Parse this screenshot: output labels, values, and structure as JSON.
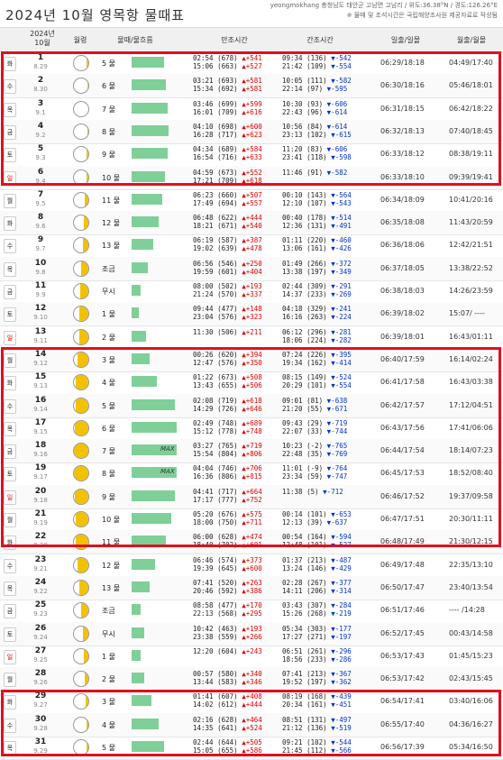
{
  "header": {
    "title": "2024년 10월 영목항 물때표",
    "sub1": "yeongmokhang 충청남도 태안군 고남면 고남리 / 위도:36.38°N / 경도:126.26°E",
    "sub2": "※ 물때 및 조석시간은 국립해양조사원 제공자료로 작성됨"
  },
  "columns": {
    "date": "2024년\n10월",
    "moon": "월령",
    "mul": "물때/물흐름",
    "high": "만조시간",
    "low": "간조시간",
    "sun": "일출/일몰",
    "moonrise": "월출/월몰"
  },
  "rows": [
    {
      "dow": "화",
      "sun": false,
      "day": "1",
      "date": "8.29",
      "phase": 0.15,
      "mul": "5 물",
      "bar": 36,
      "hi": [
        "02:54 (678)",
        "▲+541",
        "15:06 (663)",
        "▲+527"
      ],
      "lo": [
        "09:34 (136)",
        "▼-542",
        "21:42 (109)",
        "▼-554"
      ],
      "sunT": "06:29/18:18",
      "moonT": "04:49/17:40"
    },
    {
      "dow": "수",
      "sun": false,
      "day": "2",
      "date": "8.30",
      "phase": 0.05,
      "mul": "6 물",
      "bar": 38,
      "hi": [
        "03:21 (693)",
        "▲+581",
        "15:34 (692)",
        "▲+581"
      ],
      "lo": [
        "10:05 (111)",
        "▼-582",
        "22:14 (97)",
        "▼-595"
      ],
      "sunT": "06:30/18:16",
      "moonT": "05:46/18:01"
    },
    {
      "dow": "목",
      "sun": false,
      "day": "3",
      "date": "9.1",
      "phase": 0.0,
      "mul": "7 물",
      "bar": 40,
      "hi": [
        "03:46 (699)",
        "▲+599",
        "16:01 (709)",
        "▲+616"
      ],
      "lo": [
        "10:30 (93)",
        "▼-606",
        "22:43 (96)",
        "▼-614"
      ],
      "sunT": "06:31/18:15",
      "moonT": "06:42/18:22"
    },
    {
      "dow": "금",
      "sun": false,
      "day": "4",
      "date": "9.2",
      "phase": 0.05,
      "mul": "8 물",
      "bar": 41,
      "hi": [
        "04:10 (698)",
        "▲+600",
        "16:28 (717)",
        "▲+623"
      ],
      "lo": [
        "10:56 (84)",
        "▼-614",
        "23:13 (102)",
        "▼-615"
      ],
      "sunT": "06:32/18:13",
      "moonT": "07:40/18:45"
    },
    {
      "dow": "토",
      "sun": false,
      "day": "5",
      "date": "9.3",
      "phase": 0.1,
      "mul": "9 물",
      "bar": 40,
      "hi": [
        "04:34 (689)",
        "▲+584",
        "16:54 (716)",
        "▲+633"
      ],
      "lo": [
        "11:20 (83)",
        "▼-606",
        "23:41 (118)",
        "▼-598"
      ],
      "sunT": "06:33/18:12",
      "moonT": "08:38/19:11"
    },
    {
      "dow": "일",
      "sun": true,
      "day": "6",
      "date": "9.4",
      "phase": 0.15,
      "mul": "10 물",
      "bar": 37,
      "hi": [
        "04:59 (673)",
        "▲+552",
        "17:21 (709)",
        "▲+618"
      ],
      "lo": [
        "11:46 (91)",
        "▼-582",
        "",
        " "
      ],
      "sunT": "06:33/18:10",
      "moonT": "09:39/19:41"
    },
    {
      "dow": "월",
      "sun": false,
      "day": "7",
      "date": "9.5",
      "phase": 0.25,
      "mul": "11 물",
      "bar": 34,
      "hi": [
        "06:23 (660)",
        "▲+507",
        "17:49 (694)",
        "▲+557"
      ],
      "lo": [
        "00:10 (143)",
        "▼-564",
        "12:10 (107)",
        "▼-543"
      ],
      "sunT": "06:34/18:09",
      "moonT": "10:41/20:16"
    },
    {
      "dow": "화",
      "sun": false,
      "day": "8",
      "date": "9.6",
      "phase": 0.3,
      "mul": "12 물",
      "bar": 30,
      "hi": [
        "06:48 (622)",
        "▲+444",
        "18:21 (671)",
        "▲+540"
      ],
      "lo": [
        "00:40 (178)",
        "▼-514",
        "12:36 (131)",
        "▼-491"
      ],
      "sunT": "06:35/18:08",
      "moonT": "11:43/20:59"
    },
    {
      "dow": "수",
      "sun": false,
      "day": "9",
      "date": "9.7",
      "phase": 0.4,
      "mul": "13 물",
      "bar": 24,
      "hi": [
        "06:19 (587)",
        "▲+387",
        "19:02 (639)",
        "▲+478"
      ],
      "lo": [
        "01:11 (220)",
        "▼-460",
        "13:06 (161)",
        "▼-426"
      ],
      "sunT": "06:36/18:06",
      "moonT": "12:42/21:51"
    },
    {
      "dow": "목",
      "sun": false,
      "day": "10",
      "date": "9.8",
      "phase": 0.5,
      "mul": "조금",
      "bar": 18,
      "hi": [
        "06:56 (546)",
        "▲+250",
        "19:59 (601)",
        "▲+404"
      ],
      "lo": [
        "01:49 (266)",
        "▼-372",
        "13:38 (197)",
        "▼-349"
      ],
      "sunT": "06:37/18:05",
      "moonT": "13:38/22:52"
    },
    {
      "dow": "금",
      "sun": false,
      "day": "11",
      "date": "9.9",
      "phase": 0.55,
      "mul": "무시",
      "bar": 10,
      "hi": [
        "08:00 (502)",
        "▲+193",
        "21:24 (570)",
        "▲+337"
      ],
      "lo": [
        "02:44 (309)",
        "▼-291",
        "14:37 (233)",
        "▼-269"
      ],
      "sunT": "06:38/18:03",
      "moonT": "14:26/23:59"
    },
    {
      "dow": "토",
      "sun": false,
      "day": "12",
      "date": "9.10",
      "phase": 0.6,
      "mul": "1 물",
      "bar": 8,
      "hi": [
        "09:44 (477)",
        "▲+148",
        "23:04 (576)",
        "▲+323"
      ],
      "lo": [
        "04:18 (329)",
        "▼-241",
        "16:16 (263)",
        "▼-224"
      ],
      "sunT": "06:39/18:02",
      "moonT": "15:07/ ----"
    },
    {
      "dow": "일",
      "sun": true,
      "day": "13",
      "date": "9.11",
      "phase": 0.65,
      "mul": "2 물",
      "bar": 16,
      "hi": [
        "11:30 (506)",
        "▲+211",
        "",
        " "
      ],
      "lo": [
        "06:12 (296)",
        "▼-281",
        "18:06 (224)",
        "▼-282"
      ],
      "sunT": "06:39/18:01",
      "moonT": "16:43/01:11"
    },
    {
      "dow": "월",
      "sun": false,
      "day": "14",
      "date": "9.12",
      "phase": 0.75,
      "mul": "3 물",
      "bar": 20,
      "hi": [
        "00:26 (620)",
        "▲+394",
        "12:47 (576)",
        "▲+350"
      ],
      "lo": [
        "07:24 (226)",
        "▼-395",
        "19:34 (162)",
        "▼-414"
      ],
      "sunT": "06:40/17:59",
      "moonT": "16:14/02:24"
    },
    {
      "dow": "화",
      "sun": false,
      "day": "15",
      "date": "9.13",
      "phase": 0.85,
      "mul": "4 물",
      "bar": 28,
      "hi": [
        "01:22 (673)",
        "▲+508",
        "13:43 (655)",
        "▲+506"
      ],
      "lo": [
        "08:15 (149)",
        "▼-524",
        "20:29 (101)",
        "▼-554"
      ],
      "sunT": "06:41/17:58",
      "moonT": "16:43/03:38"
    },
    {
      "dow": "수",
      "sun": false,
      "day": "16",
      "date": "9.14",
      "phase": 0.9,
      "mul": "5 물",
      "bar": 48,
      "hi": [
        "02:08 (719)",
        "▲+618",
        "14:29 (726)",
        "▲+646"
      ],
      "lo": [
        "09:01 (81)",
        "▼-638",
        "21:20 (55)",
        "▼-671"
      ],
      "sunT": "06:42/17:57",
      "moonT": "17:12/04:51"
    },
    {
      "dow": "목",
      "sun": false,
      "day": "17",
      "date": "9.15",
      "phase": 0.95,
      "mul": "6 물",
      "bar": 50,
      "hi": [
        "02:49 (748)",
        "▲+689",
        "15:12 (778)",
        "▲+748"
      ],
      "lo": [
        "09:43 (29)",
        "▼-719",
        "22:07 (33)",
        "▼-744"
      ],
      "sunT": "06:43/17:56",
      "moonT": "17:41/06:06"
    },
    {
      "dow": "금",
      "sun": false,
      "day": "18",
      "date": "9.16",
      "phase": 1.0,
      "mul": "7 물",
      "bar": 50,
      "max": true,
      "hi": [
        "03:27 (765)",
        "▲+719",
        "15:54 (804)",
        "▲+806"
      ],
      "lo": [
        "10:23 (-2)",
        "▼-765",
        "22:48 (35)",
        "▼-769"
      ],
      "sunT": "06:44/17:54",
      "moonT": "18:14/07:23"
    },
    {
      "dow": "토",
      "sun": false,
      "day": "19",
      "date": "9.17",
      "phase": 1.0,
      "mul": "8 물",
      "bar": 50,
      "max": true,
      "hi": [
        "04:04 (746)",
        "▲+706",
        "16:36 (806)",
        "▲+815"
      ],
      "lo": [
        "11:01 (-9)",
        "▼-764",
        "23:34 (59)",
        "▼-747"
      ],
      "sunT": "06:45/17:53",
      "moonT": "18:52/08:40"
    },
    {
      "dow": "일",
      "sun": true,
      "day": "20",
      "date": "9.18",
      "phase": 0.95,
      "mul": "9 물",
      "bar": 48,
      "hi": [
        "04:41 (717)",
        "▲+664",
        "17:17 (777)",
        "▲+752"
      ],
      "lo": [
        "11:38 (5)",
        "▼-712",
        "",
        " "
      ],
      "sunT": "06:46/17:52",
      "moonT": "19:37/09:58"
    },
    {
      "dow": "월",
      "sun": false,
      "day": "21",
      "date": "9.19",
      "phase": 0.9,
      "mul": "10 물",
      "bar": 44,
      "hi": [
        "05:20 (676)",
        "▲+575",
        "18:00 (750)",
        "▲+711"
      ],
      "lo": [
        "00:14 (101)",
        "▼-653",
        "12:13 (39)",
        "▼-637"
      ],
      "sunT": "06:47/17:51",
      "moonT": "20:30/11:11"
    },
    {
      "dow": "화",
      "sun": false,
      "day": "22",
      "date": "9.20",
      "phase": 0.85,
      "mul": "11 물",
      "bar": 38,
      "hi": [
        "06:00 (628)",
        "▲+474",
        "18:40 (702)",
        "▲+601"
      ],
      "lo": [
        "00:54 (164)",
        "▼-594",
        "12:48 (101)",
        "▼-527"
      ],
      "sunT": "06:48/17:49",
      "moonT": "21:30/12:15"
    },
    {
      "dow": "수",
      "sun": false,
      "day": "23",
      "date": "9.21",
      "phase": 0.75,
      "mul": "12 물",
      "bar": 26,
      "hi": [
        "06:46 (574)",
        "▲+373",
        "19:39 (645)",
        "▲+600"
      ],
      "lo": [
        "01:37 (213)",
        "▼-487",
        "13:24 (146)",
        "▼-429"
      ],
      "sunT": "06:49/17:48",
      "moonT": "22:35/13:10"
    },
    {
      "dow": "목",
      "sun": false,
      "day": "24",
      "date": "9.22",
      "phase": 0.65,
      "mul": "13 물",
      "bar": 20,
      "hi": [
        "07:41 (520)",
        "▲+263",
        "20:46 (592)",
        "▲+386"
      ],
      "lo": [
        "02:28 (267)",
        "▼-377",
        "14:11 (206)",
        "▼-314"
      ],
      "sunT": "06:50/17:47",
      "moonT": "23:40/13:54"
    },
    {
      "dow": "금",
      "sun": false,
      "day": "25",
      "date": "9.23",
      "phase": 0.5,
      "mul": "조금",
      "bar": 10,
      "hi": [
        "08:58 (477)",
        "▲+170",
        "22:13 (568)",
        "▲+295"
      ],
      "lo": [
        "03:43 (307)",
        "▼-284",
        "15:26 (268)",
        "▼-219"
      ],
      "sunT": "06:51/17:46",
      "moonT": "---- /14:28"
    },
    {
      "dow": "토",
      "sun": false,
      "day": "26",
      "date": "9.24",
      "phase": 0.4,
      "mul": "무시",
      "bar": 14,
      "hi": [
        "10:42 (463)",
        "▲+193",
        "23:38 (559)",
        "▲+266"
      ],
      "lo": [
        "05:34 (303)",
        "▼-177",
        "17:27 (271)",
        "▼-197"
      ],
      "sunT": "06:52/17:45",
      "moonT": "00:43/14:58"
    },
    {
      "dow": "일",
      "sun": true,
      "day": "27",
      "date": "9.25",
      "phase": 0.3,
      "mul": "1 물",
      "bar": 10,
      "hi": [
        "12:20 (604)",
        "▲+243",
        "",
        " "
      ],
      "lo": [
        "06:51 (261)",
        "▼-296",
        "18:56 (233)",
        "▼-286"
      ],
      "sunT": "06:53/17:43",
      "moonT": "01:45/15:23"
    },
    {
      "dow": "월",
      "sun": false,
      "day": "28",
      "date": "9.26",
      "phase": 0.25,
      "mul": "2 물",
      "bar": 14,
      "hi": [
        "00:57 (580)",
        "▲+340",
        "13:44 (583)",
        "▲+346"
      ],
      "lo": [
        "07:41 (213)",
        "▼-367",
        "19:52 (197)",
        "▼-362"
      ],
      "sunT": "06:53/17:42",
      "moonT": "02:43/15:45"
    },
    {
      "dow": "화",
      "sun": false,
      "day": "29",
      "date": "9.27",
      "phase": 0.2,
      "mul": "3 물",
      "bar": 22,
      "hi": [
        "01:41 (607)",
        "▲+408",
        "14:02 (612)",
        "▲+444"
      ],
      "lo": [
        "08:19 (168)",
        "▼-439",
        "20:34 (161)",
        "▼-451"
      ],
      "sunT": "06:54/17:41",
      "moonT": "03:40/16:06"
    },
    {
      "dow": "수",
      "sun": false,
      "day": "30",
      "date": "9.28",
      "phase": 0.15,
      "mul": "4 물",
      "bar": 30,
      "hi": [
        "02:16 (628)",
        "▲+464",
        "14:35 (641)",
        "▲+524"
      ],
      "lo": [
        "08:51 (131)",
        "▼-497",
        "21:12 (136)",
        "▼-519"
      ],
      "sunT": "06:55/17:40",
      "moonT": "04:36/16:27"
    },
    {
      "dow": "목",
      "sun": false,
      "day": "31",
      "date": "9.29",
      "phase": 0.1,
      "mul": "5 물",
      "bar": 36,
      "hi": [
        "02:44 (644)",
        "▲+505",
        "15:05 (655)",
        "▲+586"
      ],
      "lo": [
        "09:21 (102)",
        "▼-544",
        "21:45 (112)",
        "▼-566"
      ],
      "sunT": "06:56/17:39",
      "moonT": "05:34/16:50"
    }
  ],
  "maxLabel": "MAX",
  "colors": {
    "highlight_border": "#e01020",
    "bar": "#7fcf98",
    "moon_lit": "#f2c200",
    "rise": "#d00",
    "fall": "#0033cc"
  }
}
